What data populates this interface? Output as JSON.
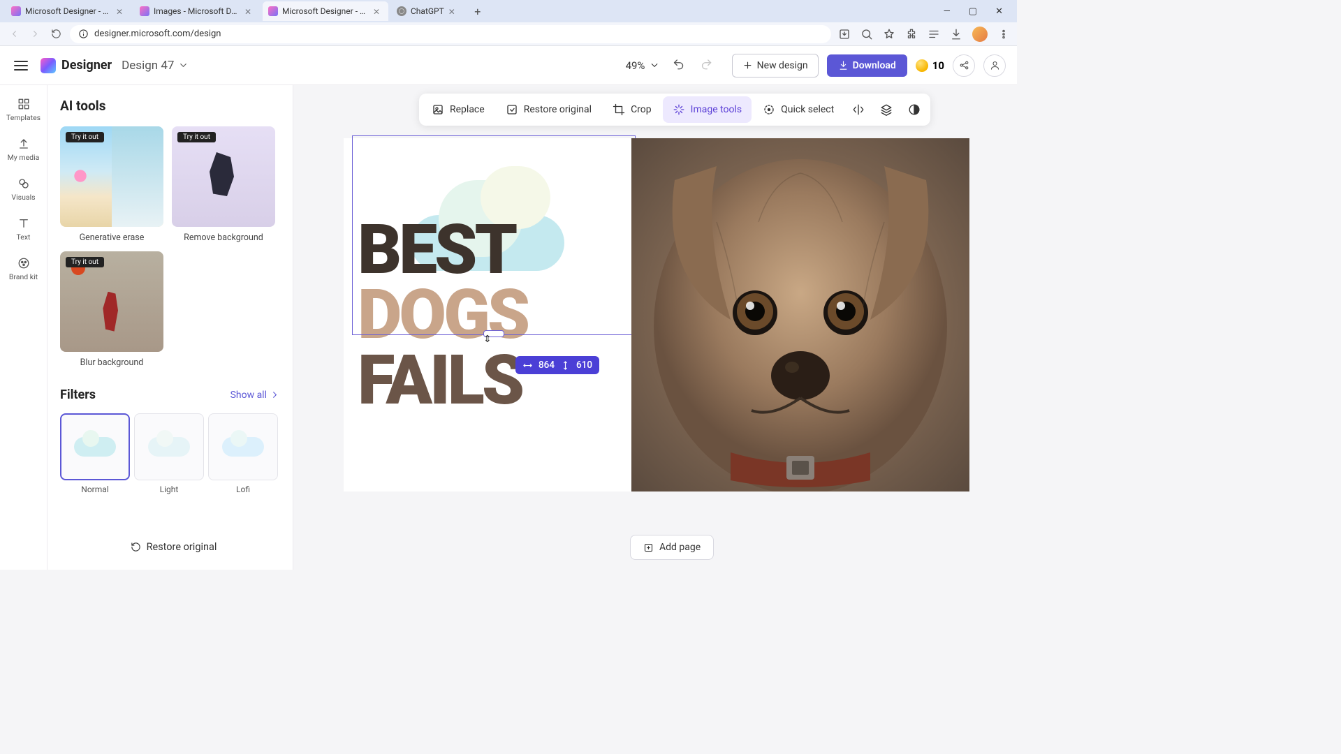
{
  "browser": {
    "tabs": [
      {
        "title": "Microsoft Designer - Stunning",
        "active": false
      },
      {
        "title": "Images - Microsoft Designer",
        "active": false
      },
      {
        "title": "Microsoft Designer - Stunning",
        "active": true
      },
      {
        "title": "ChatGPT",
        "active": false,
        "favicon": "chatgpt"
      }
    ],
    "url": "designer.microsoft.com/design"
  },
  "header": {
    "brand": "Designer",
    "design_name": "Design 47",
    "zoom": "49%",
    "new_design_label": "New design",
    "download_label": "Download",
    "credits": "10"
  },
  "rail": {
    "items": [
      {
        "label": "Templates",
        "icon": "templates"
      },
      {
        "label": "My media",
        "icon": "upload"
      },
      {
        "label": "Visuals",
        "icon": "visuals"
      },
      {
        "label": "Text",
        "icon": "text"
      },
      {
        "label": "Brand kit",
        "icon": "brandkit"
      }
    ]
  },
  "panel": {
    "ai_tools_title": "AI tools",
    "try_badge": "Try it out",
    "tools": [
      {
        "label": "Generative erase",
        "thumb": "beach"
      },
      {
        "label": "Remove background",
        "thumb": "skater"
      },
      {
        "label": "Blur background",
        "thumb": "bball"
      }
    ],
    "filters_title": "Filters",
    "show_all": "Show all",
    "filters": [
      {
        "label": "Normal",
        "selected": true,
        "variant": ""
      },
      {
        "label": "Light",
        "selected": false,
        "variant": "light"
      },
      {
        "label": "Lofi",
        "selected": false,
        "variant": "lofi"
      }
    ],
    "restore_label": "Restore original"
  },
  "context_toolbar": {
    "items": [
      {
        "label": "Replace",
        "icon": "replace"
      },
      {
        "label": "Restore original",
        "icon": "restore"
      },
      {
        "label": "Crop",
        "icon": "crop"
      },
      {
        "label": "Image tools",
        "icon": "sparkle",
        "active": true
      },
      {
        "label": "Quick select",
        "icon": "quickselect"
      }
    ]
  },
  "canvas": {
    "text_lines": {
      "line1": "BEST",
      "line2": "DOGS",
      "line3": "FAILS"
    },
    "selection_size": {
      "w": "864",
      "h": "610"
    },
    "add_page_label": "Add page"
  },
  "colors": {
    "accent": "#5b57d6",
    "text_dark": "#3d332c",
    "text_tan": "#c9a58a",
    "text_brown": "#6b5548"
  }
}
